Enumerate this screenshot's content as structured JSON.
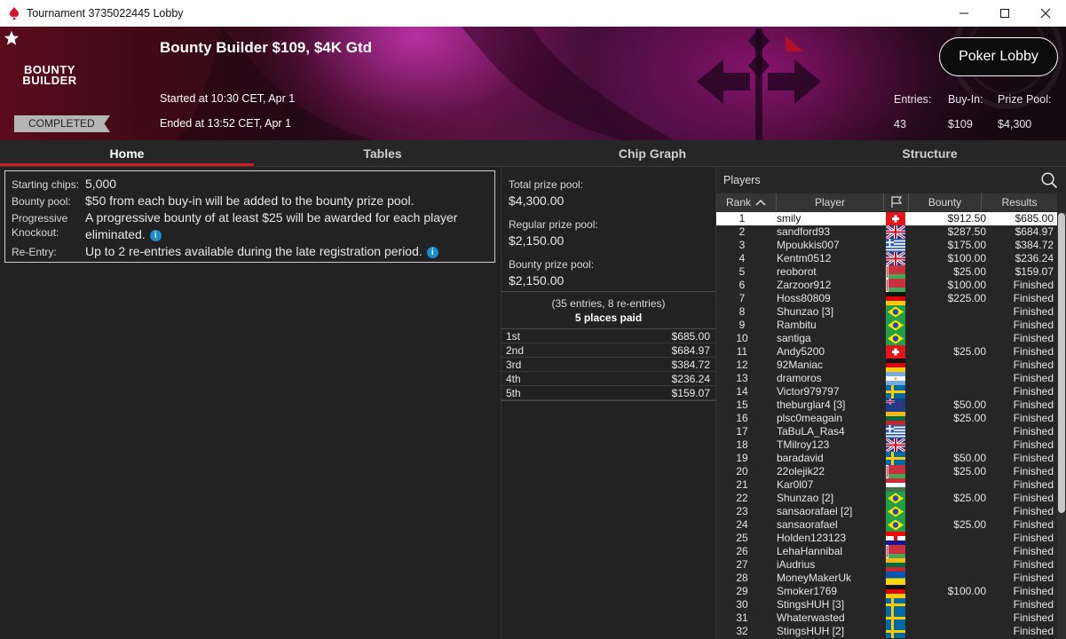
{
  "window": {
    "title": "Tournament 3735022445 Lobby"
  },
  "banner": {
    "logo_line1": "BOUNTY",
    "logo_line2": "BUILDER",
    "status": "COMPLETED",
    "tournament_name": "Bounty Builder $109, $4K Gtd",
    "started": "Started at 10:30 CET, Apr 1",
    "ended": "Ended at 13:52 CET, Apr 1",
    "lobby_button": "Poker Lobby",
    "entries_label": "Entries:",
    "entries_value": "43",
    "buyin_label": "Buy-In:",
    "buyin_value": "$109",
    "prizepool_label": "Prize Pool:",
    "prizepool_value": "$4,300"
  },
  "tabs": [
    "Home",
    "Tables",
    "Chip Graph",
    "Structure"
  ],
  "info": {
    "starting_chips_label": "Starting chips:",
    "starting_chips_value": "5,000",
    "bounty_pool_label": "Bounty pool:",
    "bounty_pool_value": "$50 from each buy-in will be added to the bounty prize pool.",
    "progressive_label_1": "Progressive",
    "progressive_label_2": "Knockout:",
    "progressive_value_1": "A progressive bounty of at least $25 will be awarded for each player",
    "progressive_value_2": "eliminated.",
    "reentry_label": "Re-Entry:",
    "reentry_value": "Up to 2 re-entries available during the late registration period."
  },
  "prize": {
    "total_label": "Total prize pool:",
    "total_value": "$4,300.00",
    "regular_label": "Regular prize pool:",
    "regular_value": "$2,150.00",
    "bounty_label": "Bounty prize pool:",
    "bounty_value": "$2,150.00",
    "entries_text": "(35 entries, 8 re-entries)",
    "places_text": "5 places paid",
    "places": [
      {
        "place": "1st",
        "amount": "$685.00"
      },
      {
        "place": "2nd",
        "amount": "$684.97"
      },
      {
        "place": "3rd",
        "amount": "$384.72"
      },
      {
        "place": "4th",
        "amount": "$236.24"
      },
      {
        "place": "5th",
        "amount": "$159.07"
      }
    ]
  },
  "players": {
    "title": "Players",
    "headers": {
      "rank": "Rank",
      "player": "Player",
      "bounty": "Bounty",
      "results": "Results"
    },
    "rows": [
      {
        "rank": "1",
        "name": "smily",
        "flag": "ch",
        "bounty": "$912.50",
        "result": "$685.00"
      },
      {
        "rank": "2",
        "name": "sandford93",
        "flag": "uk",
        "bounty": "$287.50",
        "result": "$684.97"
      },
      {
        "rank": "3",
        "name": "Mpoukkis007",
        "flag": "gr",
        "bounty": "$175.00",
        "result": "$384.72"
      },
      {
        "rank": "4",
        "name": "Kentm0512",
        "flag": "uk",
        "bounty": "$100.00",
        "result": "$236.24"
      },
      {
        "rank": "5",
        "name": "reoborot",
        "flag": "by",
        "bounty": "$25.00",
        "result": "$159.07"
      },
      {
        "rank": "6",
        "name": "Zarzoor912",
        "flag": "by",
        "bounty": "$100.00",
        "result": "Finished"
      },
      {
        "rank": "7",
        "name": "Hoss80809",
        "flag": "de",
        "bounty": "$225.00",
        "result": "Finished"
      },
      {
        "rank": "8",
        "name": "Shunzao [3]",
        "flag": "br",
        "bounty": "",
        "result": "Finished"
      },
      {
        "rank": "9",
        "name": "Rambitu",
        "flag": "br",
        "bounty": "",
        "result": "Finished"
      },
      {
        "rank": "10",
        "name": "santiga",
        "flag": "br",
        "bounty": "",
        "result": "Finished"
      },
      {
        "rank": "11",
        "name": "Andy5200",
        "flag": "ch",
        "bounty": "$25.00",
        "result": "Finished"
      },
      {
        "rank": "12",
        "name": "92Maniac",
        "flag": "de",
        "bounty": "",
        "result": "Finished"
      },
      {
        "rank": "13",
        "name": "dramoros",
        "flag": "ar",
        "bounty": "",
        "result": "Finished"
      },
      {
        "rank": "14",
        "name": "Victor979797",
        "flag": "se",
        "bounty": "",
        "result": "Finished"
      },
      {
        "rank": "15",
        "name": "theburglar4 [3]",
        "flag": "nz",
        "bounty": "$50.00",
        "result": "Finished"
      },
      {
        "rank": "16",
        "name": "plsc0meagain",
        "flag": "lt",
        "bounty": "$25.00",
        "result": "Finished"
      },
      {
        "rank": "17",
        "name": "TaBuLA_Ras4",
        "flag": "gr",
        "bounty": "",
        "result": "Finished"
      },
      {
        "rank": "18",
        "name": "TMilroy123",
        "flag": "uk",
        "bounty": "",
        "result": "Finished"
      },
      {
        "rank": "19",
        "name": "baradavid",
        "flag": "se",
        "bounty": "$50.00",
        "result": "Finished"
      },
      {
        "rank": "20",
        "name": "22olejik22",
        "flag": "by",
        "bounty": "$25.00",
        "result": "Finished"
      },
      {
        "rank": "21",
        "name": "Kar0l07",
        "flag": "hu",
        "bounty": "",
        "result": "Finished"
      },
      {
        "rank": "22",
        "name": "Shunzao [2]",
        "flag": "br",
        "bounty": "$25.00",
        "result": "Finished"
      },
      {
        "rank": "23",
        "name": "sansaorafael [2]",
        "flag": "br",
        "bounty": "",
        "result": "Finished"
      },
      {
        "rank": "24",
        "name": "sansaorafael",
        "flag": "br",
        "bounty": "$25.00",
        "result": "Finished"
      },
      {
        "rank": "25",
        "name": "Holden123123",
        "flag": "hr",
        "bounty": "",
        "result": "Finished"
      },
      {
        "rank": "26",
        "name": "LehaHannibal",
        "flag": "by",
        "bounty": "",
        "result": "Finished"
      },
      {
        "rank": "27",
        "name": "iAudrius",
        "flag": "lt",
        "bounty": "",
        "result": "Finished"
      },
      {
        "rank": "28",
        "name": "MoneyMakerUk",
        "flag": "ua",
        "bounty": "",
        "result": "Finished"
      },
      {
        "rank": "29",
        "name": "Smoker1769",
        "flag": "de",
        "bounty": "$100.00",
        "result": "Finished"
      },
      {
        "rank": "30",
        "name": "StingsHUH [3]",
        "flag": "se",
        "bounty": "",
        "result": "Finished"
      },
      {
        "rank": "31",
        "name": "Whaterwasted",
        "flag": "se",
        "bounty": "",
        "result": "Finished"
      },
      {
        "rank": "32",
        "name": "StingsHUH [2]",
        "flag": "se",
        "bounty": "",
        "result": "Finished"
      }
    ]
  },
  "colors": {
    "accent": "#d31a2a",
    "info_icon": "#1a8ccc",
    "selected_row": "#ffffff"
  },
  "icons": [
    "pokerstars-icon",
    "minimize-icon",
    "maximize-icon",
    "close-icon",
    "star-icon",
    "info-icon",
    "search-icon",
    "sort-up-icon",
    "flag-column-icon"
  ]
}
